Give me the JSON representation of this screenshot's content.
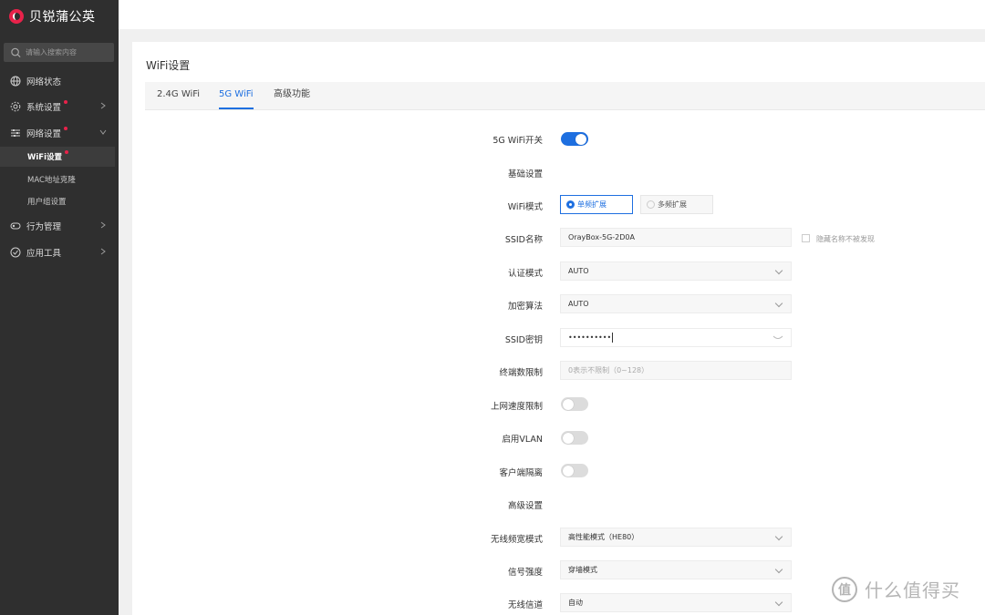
{
  "sidebar": {
    "brand": "贝锐蒲公英",
    "search_placeholder": "请输入搜索内容",
    "items": [
      {
        "label": "网络状态",
        "icon": "globe-icon"
      },
      {
        "label": "系统设置",
        "icon": "gear-icon",
        "badge": true
      },
      {
        "label": "网络设置",
        "icon": "sliders-icon",
        "badge": true,
        "expanded": true
      },
      {
        "label": "行为管理",
        "icon": "control-icon"
      },
      {
        "label": "应用工具",
        "icon": "shield-icon"
      }
    ],
    "subitems": [
      {
        "label": "WiFi设置",
        "active": true
      },
      {
        "label": "MAC地址克隆"
      },
      {
        "label": "用户组设置"
      }
    ]
  },
  "page": {
    "title": "WiFi设置",
    "tabs": [
      {
        "label": "2.4G WiFi"
      },
      {
        "label": "5G WiFi",
        "active": true
      },
      {
        "label": "高级功能"
      }
    ]
  },
  "form": {
    "wifi_switch_label": "5G WiFi开关",
    "wifi_switch_on": true,
    "basic_section": "基础设置",
    "mode_label": "WiFi模式",
    "mode_options": [
      "单频扩展",
      "多频扩展"
    ],
    "mode_selected": "单频扩展",
    "ssid_label": "SSID名称",
    "ssid_value": "OrayBox-5G-2D0A",
    "hide_ssid_label": "隐藏名称不被发现",
    "auth_label": "认证模式",
    "auth_value": "AUTO",
    "encrypt_label": "加密算法",
    "encrypt_value": "AUTO",
    "password_label": "SSID密钥",
    "password_value": "••••••••••",
    "terminal_label": "终端数限制",
    "terminal_placeholder": "0表示不限制（0~128）",
    "speed_limit_label": "上网速度限制",
    "speed_limit_on": false,
    "vlan_label": "启用VLAN",
    "vlan_on": false,
    "isolation_label": "客户端隔离",
    "isolation_on": false,
    "advanced_section": "高级设置",
    "bandwidth_label": "无线频宽模式",
    "bandwidth_value": "高性能模式（HE80）",
    "signal_label": "信号强度",
    "signal_value": "穿墙模式",
    "channel_label": "无线信道",
    "channel_value": "自动"
  },
  "watermark": {
    "logo": "值",
    "text": "什么值得买"
  },
  "colors": {
    "accent": "#1e6fe0",
    "sidebar_bg": "#2f2f2f",
    "badge": "#e8224a"
  }
}
